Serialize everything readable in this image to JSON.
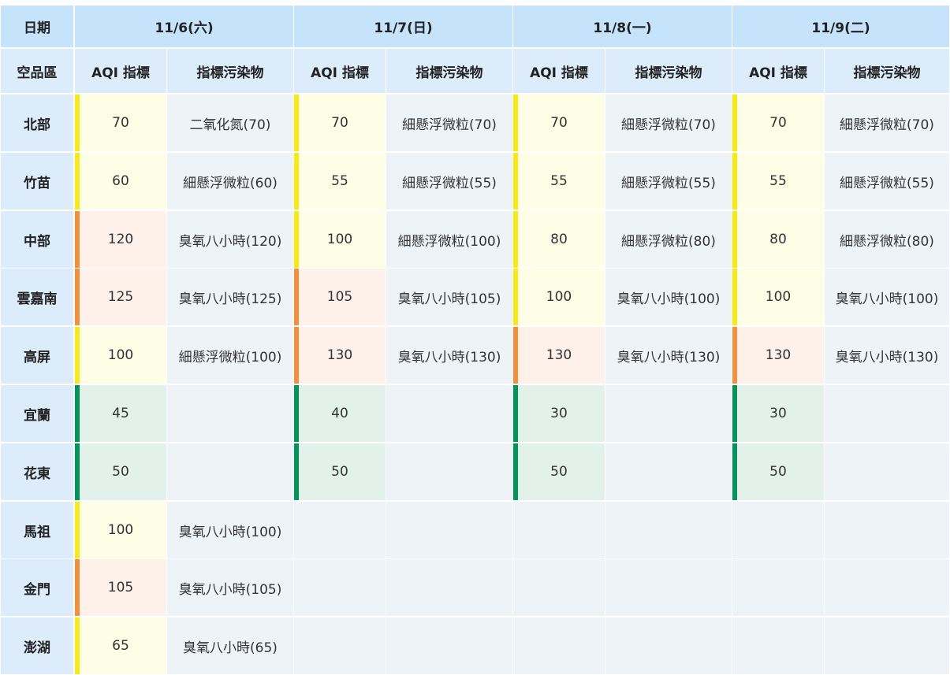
{
  "header": {
    "date_label": "日期",
    "region_label": "空品區",
    "aqi_label": "AQI 指標",
    "pollutant_label": "指標污染物"
  },
  "days": [
    "11/6(六)",
    "11/7(日)",
    "11/8(一)",
    "11/9(二)"
  ],
  "level_colors": {
    "good": {
      "bar": "#00965a",
      "bg": "#e2f1ea"
    },
    "moderate": {
      "bar": "#f7eb16",
      "bg": "#fefde6"
    },
    "unhealthy_sensitive": {
      "bar": "#f4903c",
      "bg": "#fdf1ea"
    }
  },
  "rows": [
    {
      "region": "北部",
      "cells": [
        {
          "aqi": "70",
          "level": "moderate",
          "pollutant": "二氧化氮(70)"
        },
        {
          "aqi": "70",
          "level": "moderate",
          "pollutant": "細懸浮微粒(70)"
        },
        {
          "aqi": "70",
          "level": "moderate",
          "pollutant": "細懸浮微粒(70)"
        },
        {
          "aqi": "70",
          "level": "moderate",
          "pollutant": "細懸浮微粒(70)"
        }
      ]
    },
    {
      "region": "竹苗",
      "cells": [
        {
          "aqi": "60",
          "level": "moderate",
          "pollutant": "細懸浮微粒(60)"
        },
        {
          "aqi": "55",
          "level": "moderate",
          "pollutant": "細懸浮微粒(55)"
        },
        {
          "aqi": "55",
          "level": "moderate",
          "pollutant": "細懸浮微粒(55)"
        },
        {
          "aqi": "55",
          "level": "moderate",
          "pollutant": "細懸浮微粒(55)"
        }
      ]
    },
    {
      "region": "中部",
      "cells": [
        {
          "aqi": "120",
          "level": "unhealthy_sensitive",
          "pollutant": "臭氧八小時(120)"
        },
        {
          "aqi": "100",
          "level": "moderate",
          "pollutant": "細懸浮微粒(100)"
        },
        {
          "aqi": "80",
          "level": "moderate",
          "pollutant": "細懸浮微粒(80)"
        },
        {
          "aqi": "80",
          "level": "moderate",
          "pollutant": "細懸浮微粒(80)"
        }
      ]
    },
    {
      "region": "雲嘉南",
      "cells": [
        {
          "aqi": "125",
          "level": "unhealthy_sensitive",
          "pollutant": "臭氧八小時(125)"
        },
        {
          "aqi": "105",
          "level": "unhealthy_sensitive",
          "pollutant": "臭氧八小時(105)"
        },
        {
          "aqi": "100",
          "level": "moderate",
          "pollutant": "臭氧八小時(100)"
        },
        {
          "aqi": "100",
          "level": "moderate",
          "pollutant": "臭氧八小時(100)"
        }
      ]
    },
    {
      "region": "高屏",
      "cells": [
        {
          "aqi": "100",
          "level": "moderate",
          "pollutant": "細懸浮微粒(100)"
        },
        {
          "aqi": "130",
          "level": "unhealthy_sensitive",
          "pollutant": "臭氧八小時(130)"
        },
        {
          "aqi": "130",
          "level": "unhealthy_sensitive",
          "pollutant": "臭氧八小時(130)"
        },
        {
          "aqi": "130",
          "level": "unhealthy_sensitive",
          "pollutant": "臭氧八小時(130)"
        }
      ]
    },
    {
      "region": "宜蘭",
      "cells": [
        {
          "aqi": "45",
          "level": "good",
          "pollutant": ""
        },
        {
          "aqi": "40",
          "level": "good",
          "pollutant": ""
        },
        {
          "aqi": "30",
          "level": "good",
          "pollutant": ""
        },
        {
          "aqi": "30",
          "level": "good",
          "pollutant": ""
        }
      ]
    },
    {
      "region": "花東",
      "cells": [
        {
          "aqi": "50",
          "level": "good",
          "pollutant": ""
        },
        {
          "aqi": "50",
          "level": "good",
          "pollutant": ""
        },
        {
          "aqi": "50",
          "level": "good",
          "pollutant": ""
        },
        {
          "aqi": "50",
          "level": "good",
          "pollutant": ""
        }
      ]
    },
    {
      "region": "馬祖",
      "cells": [
        {
          "aqi": "100",
          "level": "moderate",
          "pollutant": "臭氧八小時(100)"
        },
        null,
        null,
        null
      ]
    },
    {
      "region": "金門",
      "cells": [
        {
          "aqi": "105",
          "level": "unhealthy_sensitive",
          "pollutant": "臭氧八小時(105)"
        },
        null,
        null,
        null
      ]
    },
    {
      "region": "澎湖",
      "cells": [
        {
          "aqi": "65",
          "level": "moderate",
          "pollutant": "臭氧八小時(65)"
        },
        null,
        null,
        null
      ]
    }
  ]
}
